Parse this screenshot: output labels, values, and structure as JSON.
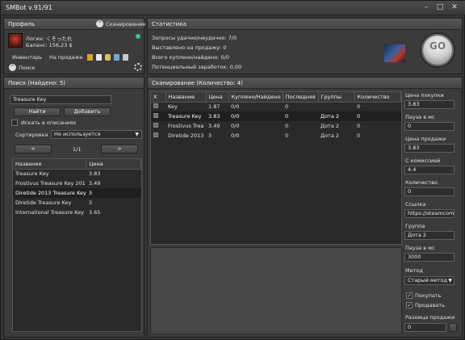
{
  "window": {
    "title": "SMBot v.91/91",
    "btn_min": "–",
    "btn_max": "□",
    "btn_close": "✕"
  },
  "profile": {
    "title": "Профиль",
    "scan_label": "Сканирование",
    "login": "Логин: くそったれ",
    "balance": "Баланс: 156,23 $",
    "inventory": "Инвентарь",
    "on_sale": "На продаже",
    "search_label": "Поиск"
  },
  "stats": {
    "title": "Статистика",
    "requests": "Запросы удачно/неудачно: 7/0",
    "put_on_sale": "Выставлено на продажу: 0",
    "bought_found": "Всего куплено/найдено: 0/0",
    "potential": "Потенциальный заработок: 0,00",
    "go": "GO"
  },
  "search": {
    "title": "Поиск (Найдено: 5)",
    "query": "Treasure Key",
    "find_btn": "Найти",
    "add_btn": "Добавить",
    "in_desc": "Искать в описаниях",
    "sort_label": "Сортировка",
    "sort_value": "Не используется",
    "prev": "<",
    "page": "1/1",
    "next": ">",
    "columns": [
      "Название",
      "Цена"
    ],
    "rows": [
      {
        "name": "Treasure Key",
        "price": "3.83"
      },
      {
        "name": "Frostivus Treasure Key 201",
        "price": "3.49"
      },
      {
        "name": "Diretide 2013 Treasure Key",
        "price": "3"
      },
      {
        "name": "Diretide Treasure Key",
        "price": "3"
      },
      {
        "name": "International Treasure Key",
        "price": "3.65"
      }
    ],
    "selected_row": 2
  },
  "scan": {
    "title": "Сканирование (Количество: 4)",
    "columns": [
      "X",
      "Название",
      "Цена",
      "Куплено/Найдено",
      "Последняя",
      "Группы",
      "Количество"
    ],
    "rows": [
      {
        "name": "Key",
        "price": "1.87",
        "bought": "0/0",
        "last": "0",
        "group": "",
        "qty": "0"
      },
      {
        "name": "Treasure Key",
        "price": "3.83",
        "bought": "0/0",
        "last": "0",
        "group": "Дота 2",
        "qty": "0"
      },
      {
        "name": "Frostivus Trea",
        "price": "3.49",
        "bought": "0/0",
        "last": "0",
        "group": "Дота 2",
        "qty": "0"
      },
      {
        "name": "Diretide 2013",
        "price": "3",
        "bought": "0/0",
        "last": "0",
        "group": "Дота 2",
        "qty": "0"
      }
    ],
    "selected_row": 1
  },
  "details": {
    "buy_price_label": "Цена покупки",
    "buy_price": "3.83",
    "pause_label": "Пауза в мс",
    "pause": "0",
    "sell_price_label": "Цена продажи",
    "sell_price": "3.83",
    "with_fee_label": "С комиссией",
    "with_fee": "4.4",
    "qty_label": "Количество",
    "qty": "0",
    "link_label": "Ссылка",
    "link": "https://steamcommun",
    "group_label": "Группа",
    "group": "Дота 2",
    "pause2_label": "Пауза в мс",
    "pause2": "3000",
    "method_label": "Метод",
    "method": "Старый метод",
    "buy_check": "Покупать",
    "sell_check": "Продавать",
    "diff_label": "Разница продажи",
    "diff": "0"
  }
}
